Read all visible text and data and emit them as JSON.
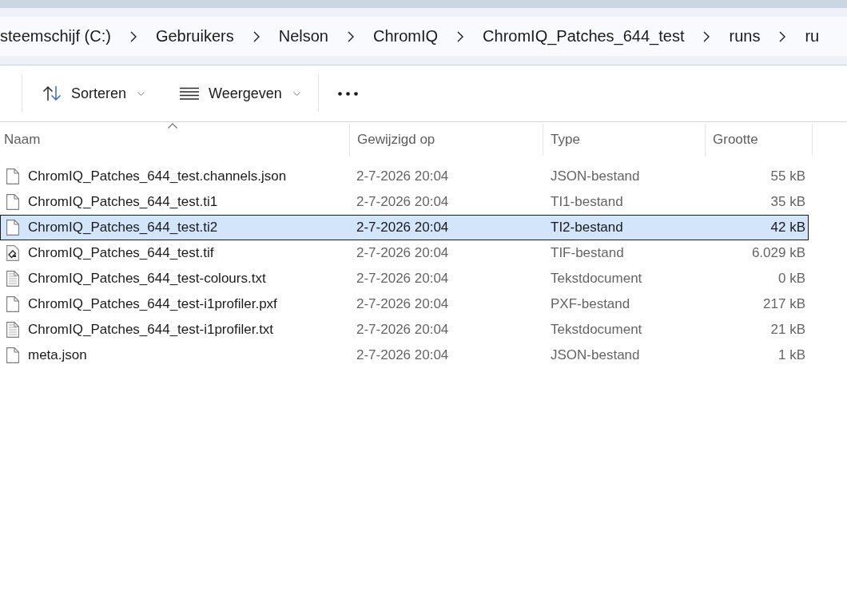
{
  "address_bar": {
    "path": [
      "steemschijf (C:)",
      "Gebruikers",
      "Nelson",
      "ChromIQ",
      "ChromIQ_Patches_644_test",
      "runs",
      "ru"
    ]
  },
  "toolbar": {
    "items": [
      {
        "kind": "sort",
        "label": "Sorteren"
      },
      {
        "kind": "view",
        "label": "Weergeven"
      },
      {
        "kind": "more"
      }
    ]
  },
  "file_list": {
    "columns": [
      {
        "label": "Naam",
        "sorted": true
      },
      {
        "label": "Gewijzigd op",
        "sorted": false
      },
      {
        "label": "Type",
        "sorted": false
      },
      {
        "label": "Grootte",
        "sorted": false
      }
    ],
    "rows": [
      {
        "kind": "file",
        "name": "ChromIQ_Patches_644_test.channels.json",
        "modified": "2-7-2026 20:04",
        "type": "JSON-bestand",
        "size": "55 kB",
        "selected": false
      },
      {
        "kind": "file",
        "name": "ChromIQ_Patches_644_test.ti1",
        "modified": "2-7-2026 20:04",
        "type": "TI1-bestand",
        "size": "35 kB",
        "selected": false
      },
      {
        "kind": "file",
        "name": "ChromIQ_Patches_644_test.ti2",
        "modified": "2-7-2026 20:04",
        "type": "TI2-bestand",
        "size": "42 kB",
        "selected": true
      },
      {
        "kind": "image",
        "name": "ChromIQ_Patches_644_test.tif",
        "modified": "2-7-2026 20:04",
        "type": "TIF-bestand",
        "size": "6.029 kB",
        "selected": false
      },
      {
        "kind": "text",
        "name": "ChromIQ_Patches_644_test-colours.txt",
        "modified": "2-7-2026 20:04",
        "type": "Tekstdocument",
        "size": "0 kB",
        "selected": false
      },
      {
        "kind": "file",
        "name": "ChromIQ_Patches_644_test-i1profiler.pxf",
        "modified": "2-7-2026 20:04",
        "type": "PXF-bestand",
        "size": "217 kB",
        "selected": false
      },
      {
        "kind": "text",
        "name": "ChromIQ_Patches_644_test-i1profiler.txt",
        "modified": "2-7-2026 20:04",
        "type": "Tekstdocument",
        "size": "21 kB",
        "selected": false
      },
      {
        "kind": "file",
        "name": "meta.json",
        "modified": "2-7-2026 20:04",
        "type": "JSON-bestand",
        "size": "1 kB",
        "selected": false
      }
    ]
  }
}
